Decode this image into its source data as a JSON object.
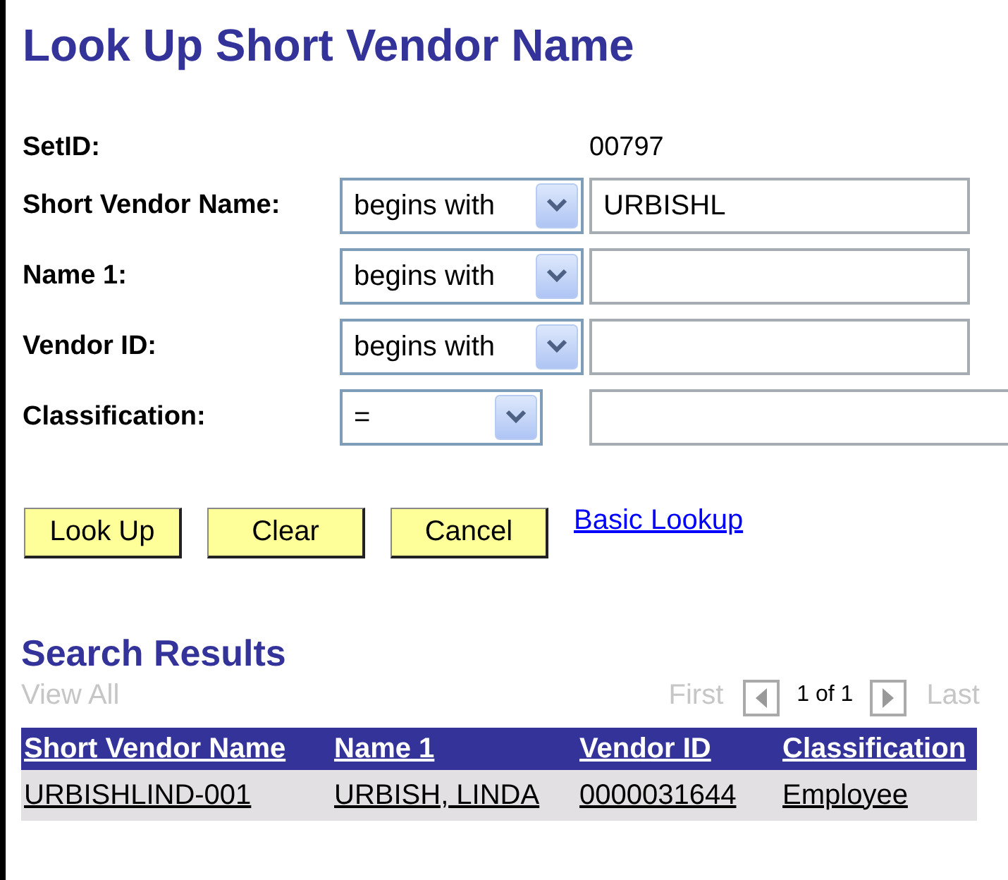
{
  "title": "Look Up Short Vendor Name",
  "setid": {
    "label": "SetID:",
    "value": "00797"
  },
  "criteria": [
    {
      "label": "Short Vendor Name:",
      "operator": "begins with",
      "value": "URBISHL",
      "kind": "wide"
    },
    {
      "label": "Name 1:",
      "operator": "begins with",
      "kind": "wide"
    },
    {
      "label": "Vendor ID:",
      "operator": "begins with",
      "kind": "wide"
    },
    {
      "label": "Classification:",
      "operator": "=",
      "kind": "narrow"
    }
  ],
  "buttons": [
    "Look Up",
    "Clear",
    "Cancel"
  ],
  "link": "Basic Lookup",
  "results": {
    "heading": "Search Results",
    "view_all": {
      "label": "View All",
      "disabled": true
    },
    "first": {
      "label": "First",
      "disabled": true
    },
    "count": "1 of 1",
    "last": {
      "label": "Last",
      "disabled": true
    },
    "columns": [
      "Short Vendor Name",
      "Name 1",
      "Vendor ID",
      "Classification"
    ],
    "rows": [
      [
        "URBISHLIND-001",
        "URBISH, LINDA",
        "0000031644",
        "Employee"
      ]
    ]
  }
}
